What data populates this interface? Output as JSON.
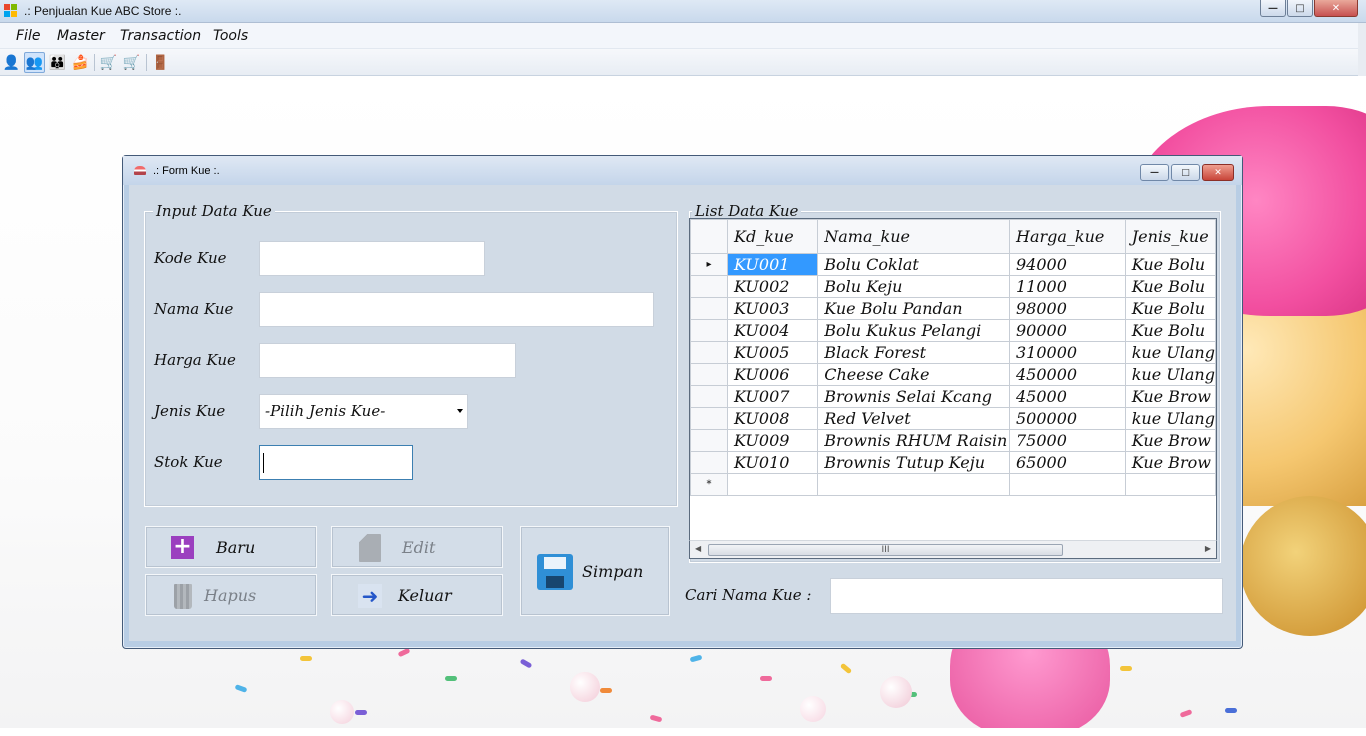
{
  "app": {
    "title": ".: Penjualan Kue ABC Store :.",
    "caption": {
      "minimize": "—",
      "maximize": "□",
      "close": "✕"
    }
  },
  "menu": [
    "File",
    "Master",
    "Transaction",
    "Tools"
  ],
  "toolbar": [
    {
      "icon": "user-icon",
      "glyph": "👤"
    },
    {
      "icon": "user-edit-icon",
      "glyph": "👥",
      "active": true
    },
    {
      "icon": "users-icon",
      "glyph": "👪"
    },
    {
      "icon": "cake-icon",
      "glyph": "🍰"
    },
    {
      "icon": "cart-add-icon",
      "glyph": "🛒"
    },
    {
      "icon": "cart-icon",
      "glyph": "🛒"
    },
    {
      "icon": "exit-icon",
      "glyph": "🚪"
    }
  ],
  "form": {
    "title": ".: Form Kue :.",
    "caption": {
      "minimize": "—",
      "maximize": "□",
      "close": "✕"
    },
    "input_group": "Input Data Kue",
    "fields": {
      "kode_label": "Kode Kue",
      "nama_label": "Nama Kue",
      "harga_label": "Harga Kue",
      "jenis_label": "Jenis Kue",
      "jenis_value": "-Pilih Jenis Kue-",
      "stok_label": "Stok Kue"
    },
    "buttons": {
      "baru": "Baru",
      "edit": "Edit",
      "hapus": "Hapus",
      "keluar": "Keluar",
      "simpan": "Simpan"
    },
    "list_group": "List Data Kue",
    "grid": {
      "columns": [
        "Kd_kue",
        "Nama_kue",
        "Harga_kue",
        "Jenis_kue"
      ],
      "rows": [
        [
          "KU001",
          "Bolu Coklat",
          "94000",
          "Kue Bolu"
        ],
        [
          "KU002",
          "Bolu Keju",
          "11000",
          "Kue Bolu"
        ],
        [
          "KU003",
          "Kue Bolu Pandan",
          "98000",
          "Kue Bolu"
        ],
        [
          "KU004",
          "Bolu Kukus Pelangi",
          "90000",
          "Kue Bolu"
        ],
        [
          "KU005",
          "Black Forest",
          "310000",
          "kue Ulang"
        ],
        [
          "KU006",
          "Cheese Cake",
          "450000",
          "kue Ulang"
        ],
        [
          "KU007",
          "Brownis Selai Kcang",
          "45000",
          "Kue Brow"
        ],
        [
          "KU008",
          "Red Velvet",
          "500000",
          "kue Ulang"
        ],
        [
          "KU009",
          "Brownis RHUM Raisin",
          "75000",
          "Kue Brow"
        ],
        [
          "KU010",
          "Brownis Tutup Keju",
          "65000",
          "Kue Brow"
        ]
      ],
      "selected_row": 0,
      "current_marker": "▸",
      "new_row_marker": "*",
      "scroll_grip": "III"
    },
    "search_label": "Cari Nama Kue :"
  }
}
